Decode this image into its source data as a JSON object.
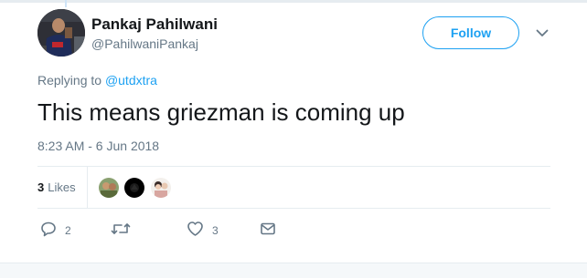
{
  "user": {
    "display_name": "Pankaj Pahilwani",
    "handle": "@PahilwaniPankaj"
  },
  "header": {
    "follow_label": "Follow"
  },
  "tweet": {
    "replying_prefix": "Replying to",
    "replying_to": "@utdxtra",
    "text": "This means griezman is coming up",
    "timestamp": "8:23 AM - 6 Jun 2018"
  },
  "stats": {
    "likes_count": "3",
    "likes_label": "Likes"
  },
  "actions": {
    "reply_count": "2",
    "like_count": "3"
  },
  "colors": {
    "accent": "#1da1f2",
    "secondary_text": "#657786",
    "divider": "#e6ecf0"
  },
  "icons": {
    "reply": "reply-icon",
    "retweet": "retweet-icon",
    "like": "heart-icon",
    "dm": "envelope-icon",
    "menu": "chevron-down-icon"
  }
}
